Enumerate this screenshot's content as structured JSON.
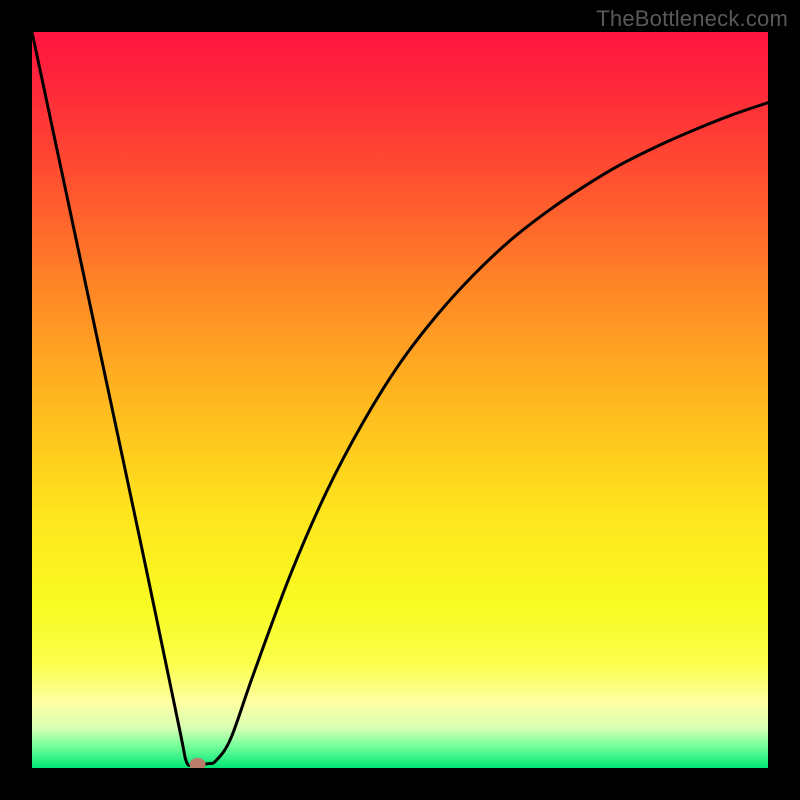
{
  "watermark": "TheBottleneck.com",
  "chart_data": {
    "type": "line",
    "title": "",
    "xlabel": "",
    "ylabel": "",
    "xlim": [
      0,
      100
    ],
    "ylim": [
      0,
      100
    ],
    "x": [
      0,
      5,
      10,
      15,
      20,
      21,
      22,
      24,
      25,
      27,
      30,
      35,
      40,
      45,
      50,
      55,
      60,
      65,
      70,
      75,
      80,
      85,
      90,
      95,
      100
    ],
    "values": [
      100,
      76.5,
      53,
      29.5,
      5.5,
      0.8,
      0.5,
      0.6,
      1.0,
      4,
      12.5,
      26,
      37.5,
      47,
      55,
      61.5,
      67,
      71.7,
      75.6,
      79,
      82,
      84.5,
      86.7,
      88.7,
      90.4
    ],
    "marker": {
      "x": 22.5,
      "y": 0.5
    },
    "colors": {
      "curve": "#000000",
      "marker": "#b97d6a",
      "gradient_stops": [
        {
          "offset": 0.0,
          "color": "#ff1440"
        },
        {
          "offset": 0.08,
          "color": "#ff2a3a"
        },
        {
          "offset": 0.2,
          "color": "#ff5030"
        },
        {
          "offset": 0.35,
          "color": "#ff8726"
        },
        {
          "offset": 0.5,
          "color": "#ffb81f"
        },
        {
          "offset": 0.65,
          "color": "#ffe41e"
        },
        {
          "offset": 0.78,
          "color": "#f8fb22"
        },
        {
          "offset": 0.86,
          "color": "#fbff4d"
        },
        {
          "offset": 0.91,
          "color": "#feffa2"
        },
        {
          "offset": 0.945,
          "color": "#d8ffb3"
        },
        {
          "offset": 0.97,
          "color": "#76ff9a"
        },
        {
          "offset": 1.0,
          "color": "#00e676"
        }
      ]
    }
  }
}
